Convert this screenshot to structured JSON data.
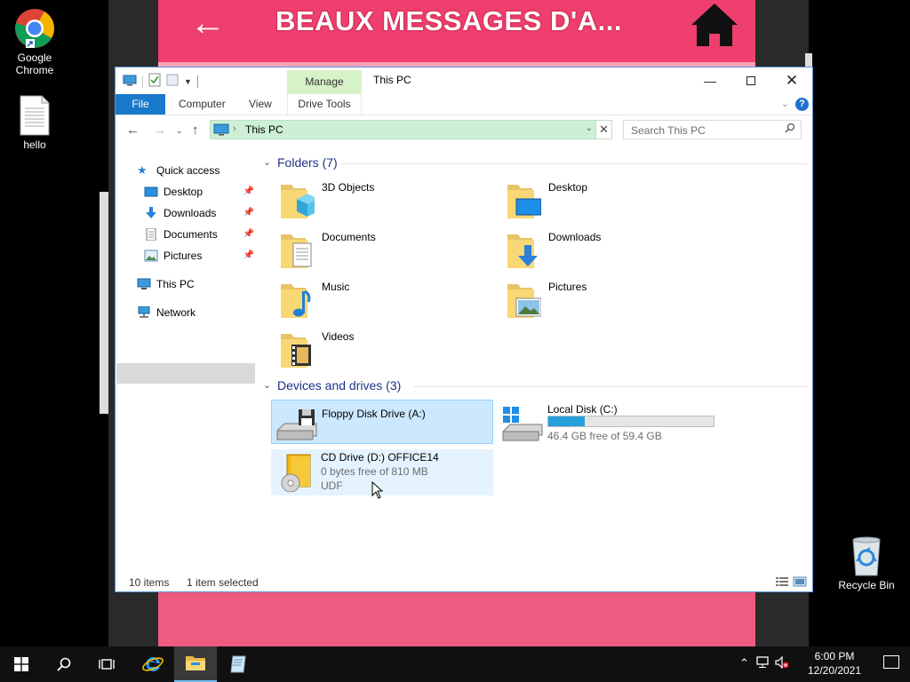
{
  "wallpaper": {
    "title": "BEAUX MESSAGES D'A...",
    "back_glyph": "←"
  },
  "desktop": {
    "icons": [
      {
        "label": "Google\nChrome",
        "icon": "chrome-icon"
      },
      {
        "label": "hello",
        "icon": "text-file-icon"
      },
      {
        "label": "Recycle Bin",
        "icon": "recycle-bin-icon"
      }
    ]
  },
  "explorer": {
    "title": "This PC",
    "contextual_tab": "Manage",
    "ribbon": {
      "tabs": [
        "File",
        "Computer",
        "View",
        "Drive Tools"
      ]
    },
    "address": {
      "path": "This PC"
    },
    "search": {
      "placeholder": "Search This PC"
    },
    "sidebar": {
      "items": [
        {
          "label": "Quick access",
          "icon": "star-icon"
        },
        {
          "label": "Desktop",
          "icon": "desktop-icon",
          "pinned": true
        },
        {
          "label": "Downloads",
          "icon": "download-icon",
          "pinned": true
        },
        {
          "label": "Documents",
          "icon": "document-icon",
          "pinned": true
        },
        {
          "label": "Pictures",
          "icon": "picture-icon",
          "pinned": true
        },
        {
          "label": "This PC",
          "icon": "this-pc-icon",
          "selected": true
        },
        {
          "label": "Network",
          "icon": "network-icon"
        }
      ]
    },
    "folders_section": {
      "title": "Folders (7)",
      "items": [
        {
          "name": "3D Objects",
          "icon": "3d-objects-folder-icon"
        },
        {
          "name": "Desktop",
          "icon": "desktop-folder-icon"
        },
        {
          "name": "Documents",
          "icon": "documents-folder-icon"
        },
        {
          "name": "Downloads",
          "icon": "downloads-folder-icon"
        },
        {
          "name": "Music",
          "icon": "music-folder-icon"
        },
        {
          "name": "Pictures",
          "icon": "pictures-folder-icon"
        },
        {
          "name": "Videos",
          "icon": "videos-folder-icon"
        }
      ]
    },
    "drives_section": {
      "title": "Devices and drives (3)",
      "items": [
        {
          "name": "Floppy Disk Drive (A:)",
          "icon": "floppy-drive-icon",
          "selected": true
        },
        {
          "name": "Local Disk (C:)",
          "icon": "local-disk-icon",
          "free_text": "46.4 GB free of 59.4 GB",
          "used_fraction": 0.22
        },
        {
          "name": "CD Drive (D:) OFFICE14",
          "icon": "cd-drive-icon",
          "free_text": "0 bytes free of 810 MB",
          "fs": "UDF"
        }
      ]
    },
    "status": {
      "items": "10 items",
      "selected": "1 item selected"
    }
  },
  "taskbar": {
    "time": "6:00 PM",
    "date": "12/20/2021"
  },
  "colors": {
    "accent": "#1979ca",
    "address_bg": "#ccefd5",
    "manage_bg": "#d8f2c8",
    "selection": "#cce8ff",
    "disk_fill": "#26a0da",
    "wallpaper_header": "#ee3f6e"
  }
}
